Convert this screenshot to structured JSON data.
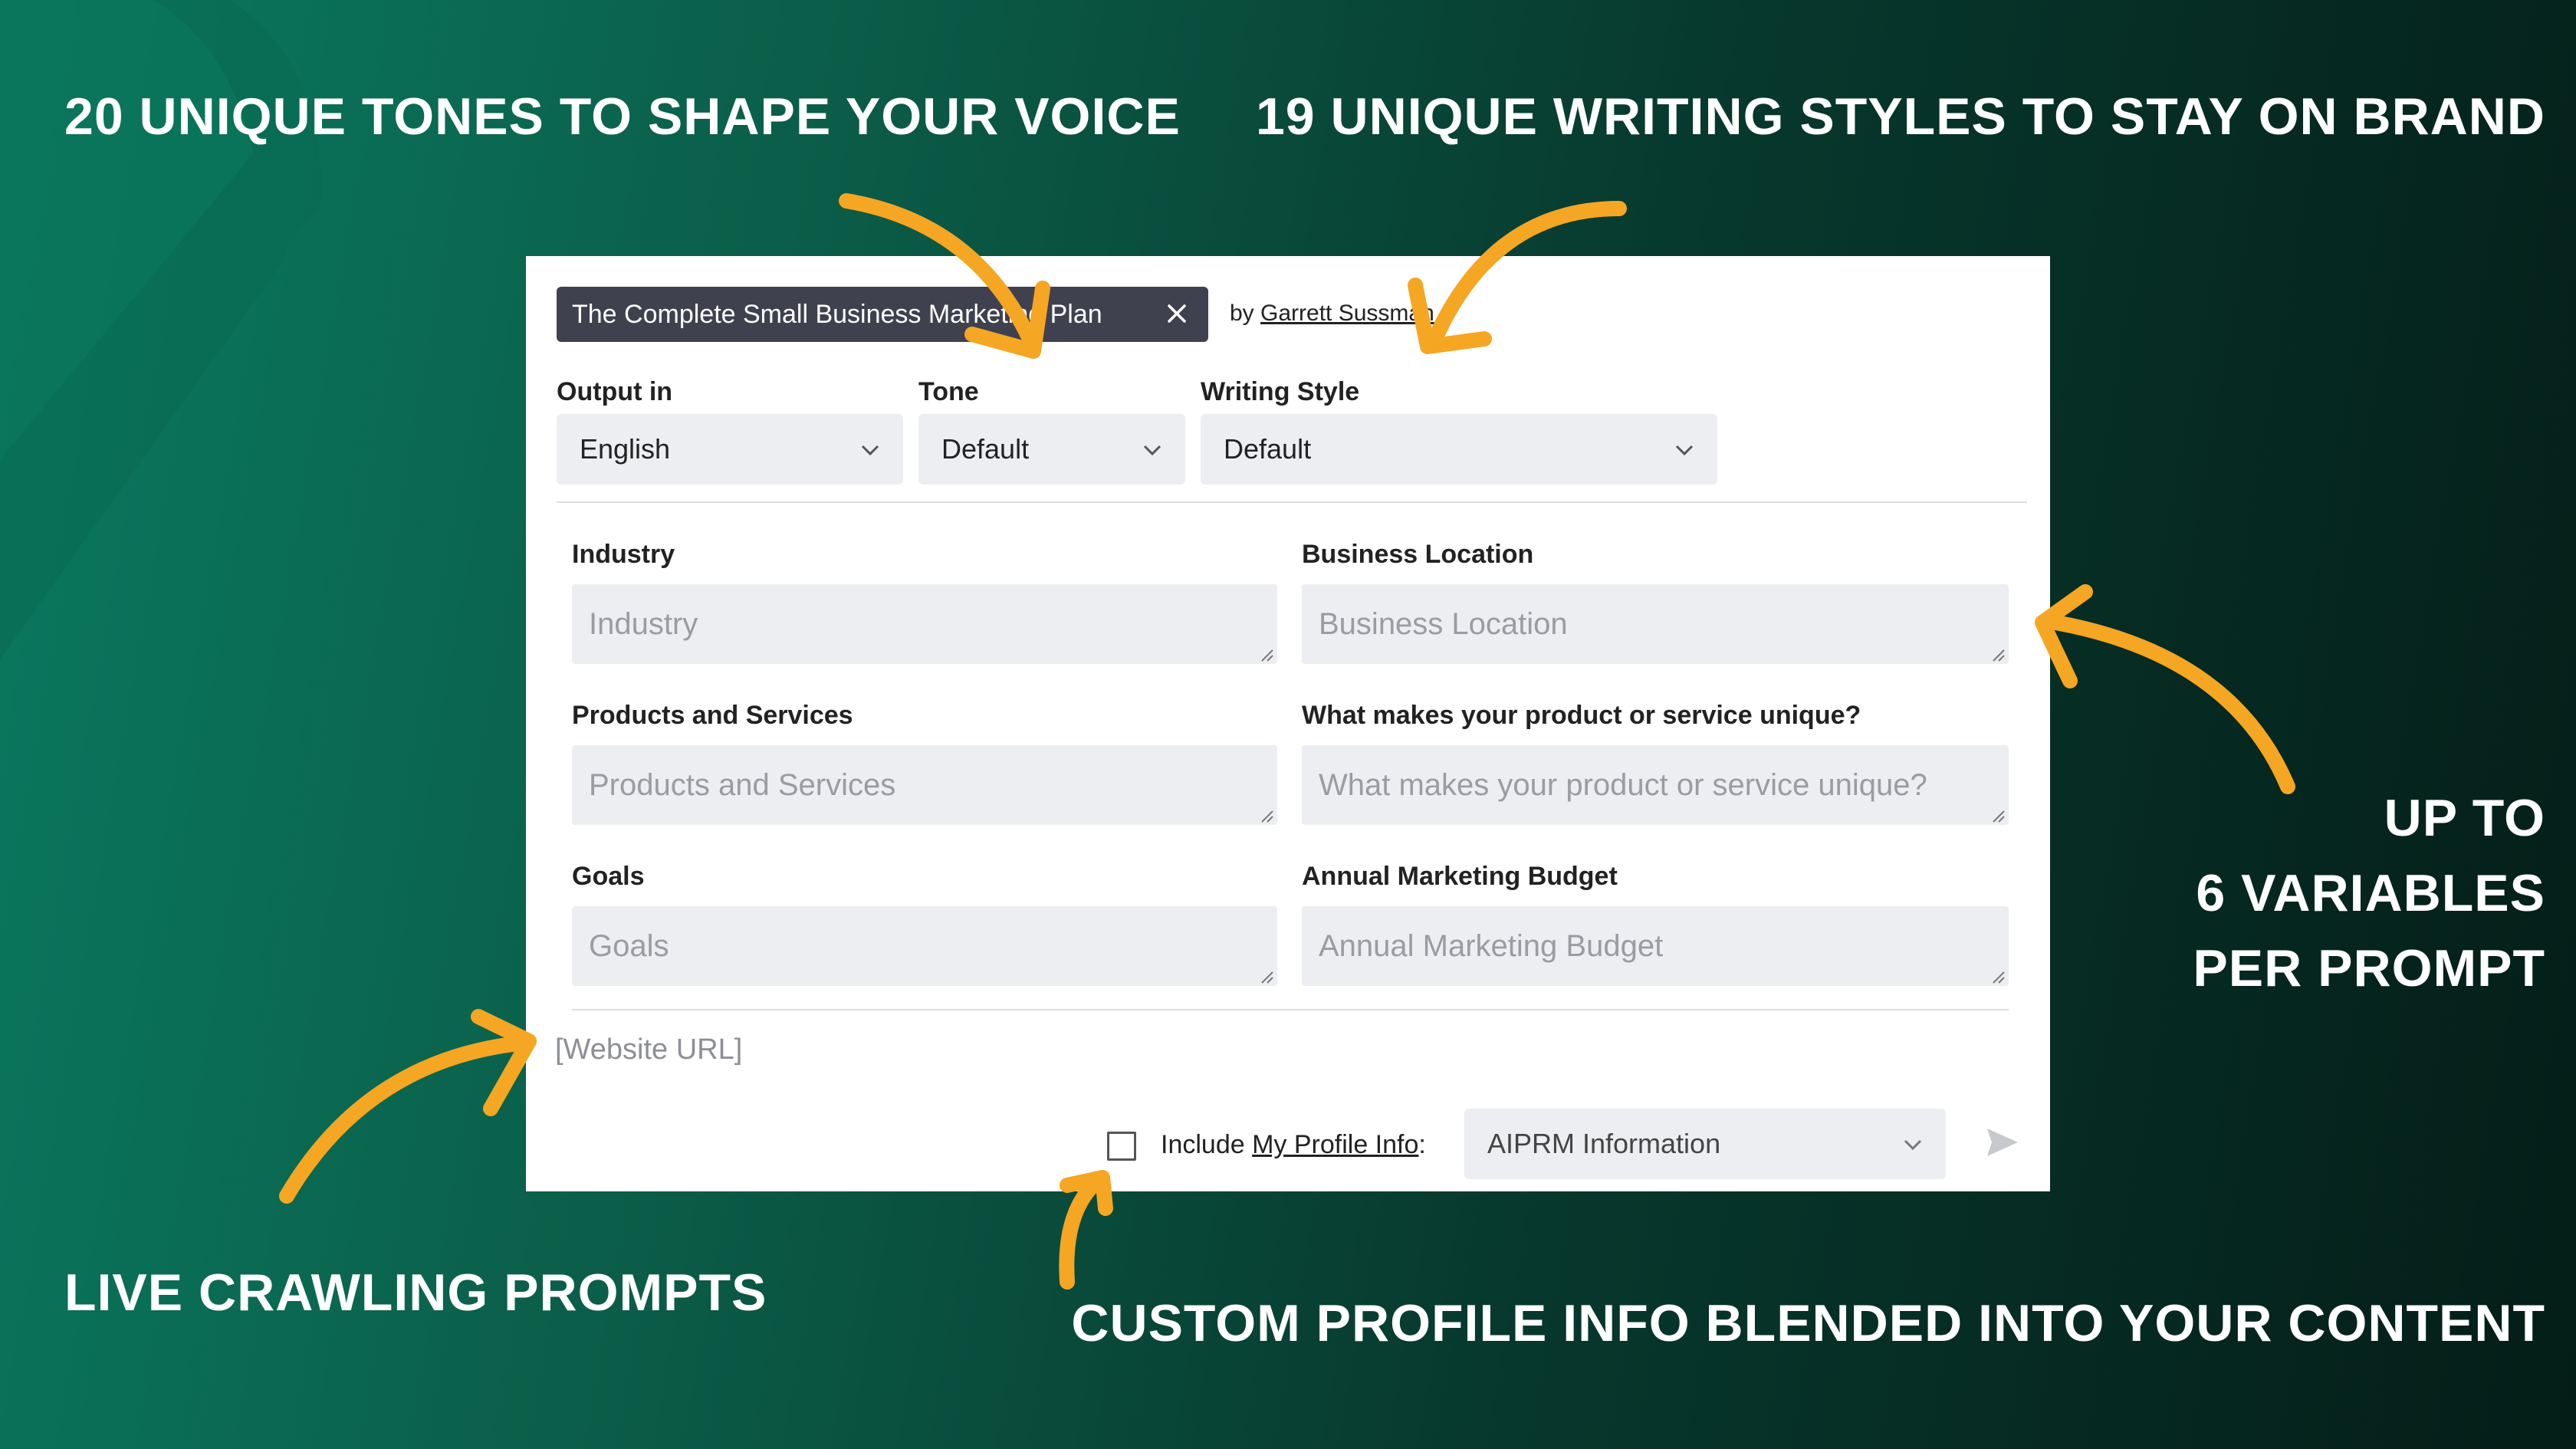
{
  "headlines": {
    "tones": "20 UNIQUE TONES TO SHAPE YOUR VOICE",
    "styles": "19 UNIQUE WRITING STYLES TO STAY ON BRAND",
    "variables_line1": "UP TO",
    "variables_line2": "6 VARIABLES",
    "variables_line3": "PER PROMPT",
    "crawling": "LIVE CRAWLING PROMPTS",
    "profile": "CUSTOM PROFILE INFO BLENDED INTO YOUR CONTENT"
  },
  "prompt": {
    "title": "The Complete Small Business Marketing Plan",
    "by_label": "by",
    "author": "Garrett Sussman"
  },
  "selects": {
    "output_label": "Output in",
    "output_value": "English",
    "tone_label": "Tone",
    "tone_value": "Default",
    "style_label": "Writing Style",
    "style_value": "Default"
  },
  "fields": [
    {
      "label": "Industry",
      "placeholder": "Industry"
    },
    {
      "label": "Business Location",
      "placeholder": "Business Location"
    },
    {
      "label": "Products and Services",
      "placeholder": "Products and Services"
    },
    {
      "label": "What makes your product or service unique?",
      "placeholder": "What makes your product or service unique?"
    },
    {
      "label": "Goals",
      "placeholder": "Goals"
    },
    {
      "label": "Annual Marketing Budget",
      "placeholder": "Annual Marketing Budget"
    }
  ],
  "footer": {
    "url_placeholder": "[Website URL]",
    "include_prefix": "Include ",
    "include_link": "My Profile Info",
    "include_suffix": ":",
    "profile_select": "AIPRM Information"
  },
  "colors": {
    "accent_arrow": "#f5a623",
    "chip_bg": "#40414f",
    "field_bg": "#eceef1",
    "panel_bg": "#ffffff"
  },
  "icons": [
    "close-icon",
    "chevron-down-icon",
    "resize-grip-icon",
    "send-icon",
    "arrow-icon"
  ]
}
